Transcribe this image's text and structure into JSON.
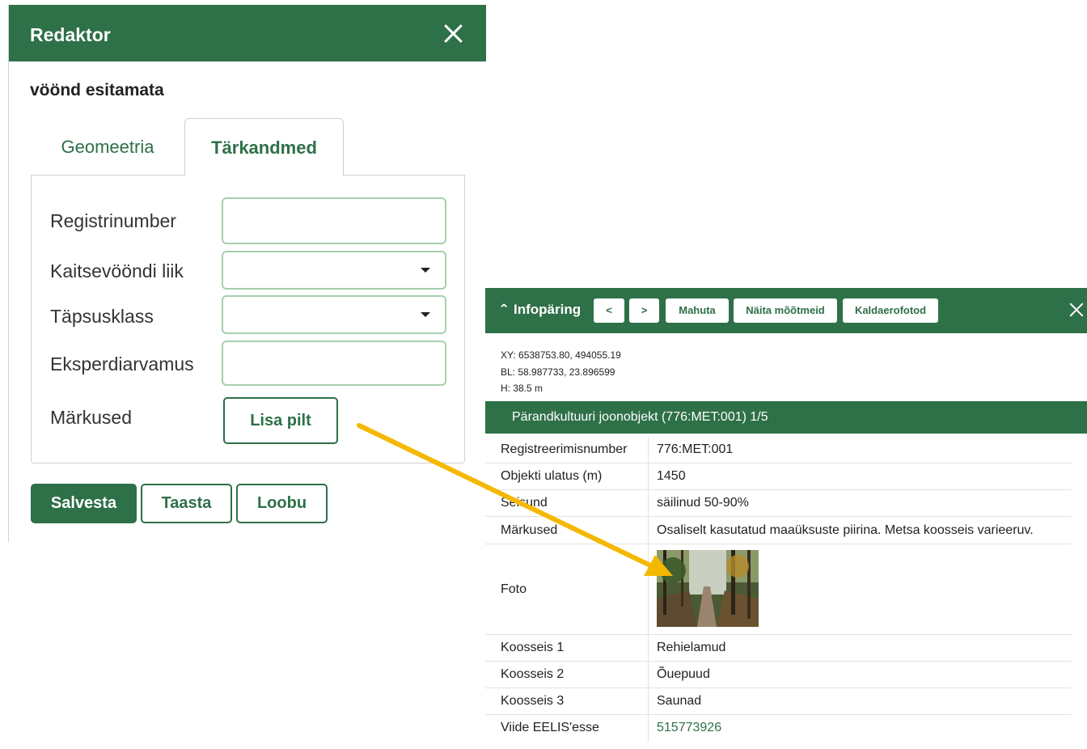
{
  "editor": {
    "title": "Redaktor",
    "subtitle": "vöönd esitamata",
    "tabs": [
      {
        "label": "Geomeetria",
        "active": false
      },
      {
        "label": "Tärkandmed",
        "active": true
      }
    ],
    "fields": {
      "registrinumber": {
        "label": "Registrinumber",
        "value": ""
      },
      "kaitsevoondi_liik": {
        "label": "Kaitsevööndi liik",
        "value": ""
      },
      "tapsusklass": {
        "label": "Täpsusklass",
        "value": ""
      },
      "eksperdiarvamus": {
        "label": "Eksperdiarvamus",
        "value": ""
      },
      "markused": {
        "label": "Märkused"
      }
    },
    "add_image_label": "Lisa pilt",
    "buttons": {
      "save": "Salvesta",
      "restore": "Taasta",
      "cancel": "Loobu"
    }
  },
  "info": {
    "title": "Infopäring",
    "buttons": {
      "prev": "<",
      "next": ">",
      "fit": "Mahuta",
      "measure": "Näita mõõtmeid",
      "oblique": "Kaldaerofotod"
    },
    "coords": {
      "xy": "XY: 6538753.80, 494055.19",
      "bl": "BL: 58.987733, 23.896599",
      "h": "H: 38.5 m"
    },
    "section_title": "Pärandkultuuri joonobjekt (776:MET:001) 1/5",
    "rows": [
      {
        "key": "Registreerimisnumber",
        "value": "776:MET:001"
      },
      {
        "key": "Objekti ulatus (m)",
        "value": "1450"
      },
      {
        "key": "Seisund",
        "value": "säilinud 50-90%"
      },
      {
        "key": "Märkused",
        "value": "Osaliselt kasutatud maaüksuste piirina. Metsa koosseis varieeruv."
      },
      {
        "key": "Foto",
        "value": "forest-path-photo"
      },
      {
        "key": "Koosseis 1",
        "value": "Rehielamud"
      },
      {
        "key": "Koosseis 2",
        "value": "Õuepuud"
      },
      {
        "key": "Koosseis 3",
        "value": "Saunad"
      },
      {
        "key": "Viide EELIS'esse",
        "value": "515773926"
      }
    ]
  },
  "colors": {
    "brand": "#2e7048",
    "arrow": "#f5b800",
    "field_border": "#a7cfae"
  },
  "icons": {
    "editor_close": "close-icon",
    "info_collapse": "double-chevron-up-icon",
    "info_close": "close-icon",
    "dropdown": "caret-down-icon"
  }
}
